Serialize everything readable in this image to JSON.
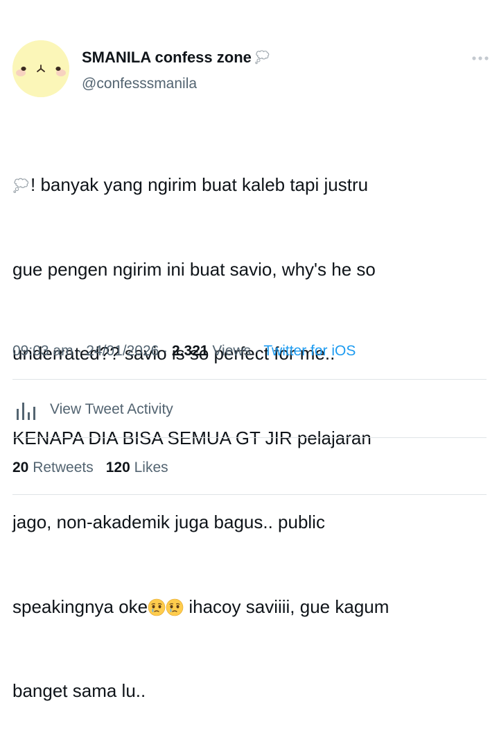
{
  "author": {
    "display_name": "SMANILA confess zone",
    "handle": "@confesssmanila",
    "avatar_icon": "cute-bear-face-icon",
    "name_badge_icon": "thought-balloon-icon",
    "avatar_bg": "#fbf6b8"
  },
  "tweet": {
    "lines": [
      "! banyak yang ngirim buat kaleb tapi justru",
      "gue pengen ngirim ini buat savio, why's he so",
      "underrated?? savio is so perfect for me..",
      "KENAPA DIA BISA SEMUA GT JIR pelajaran",
      "jago, non-akademik juga bagus.. public",
      "speakingnya oke",
      " ihacoy saviiii, gue kagum",
      "banget sama lu.."
    ],
    "leading_emoji": "thought-balloon-icon",
    "inline_emoji": "face-holding-back-tears-icon"
  },
  "meta": {
    "time": "09:03 am",
    "separator": " · ",
    "date": "24/01/2026",
    "views_count": "2.321",
    "views_label": " Views",
    "source": "Twitter for iOS"
  },
  "activity": {
    "label": "View Tweet Activity",
    "icon": "analytics-bar-chart-icon"
  },
  "stats": {
    "retweets_count": "20",
    "retweets_label": " Retweets",
    "likes_count": "120",
    "likes_label": " Likes"
  },
  "colors": {
    "text_primary": "#0f1419",
    "text_secondary": "#536471",
    "link": "#1d9bf0",
    "divider": "#dfe3e6"
  },
  "more_icon": "more-horizontal-icon"
}
